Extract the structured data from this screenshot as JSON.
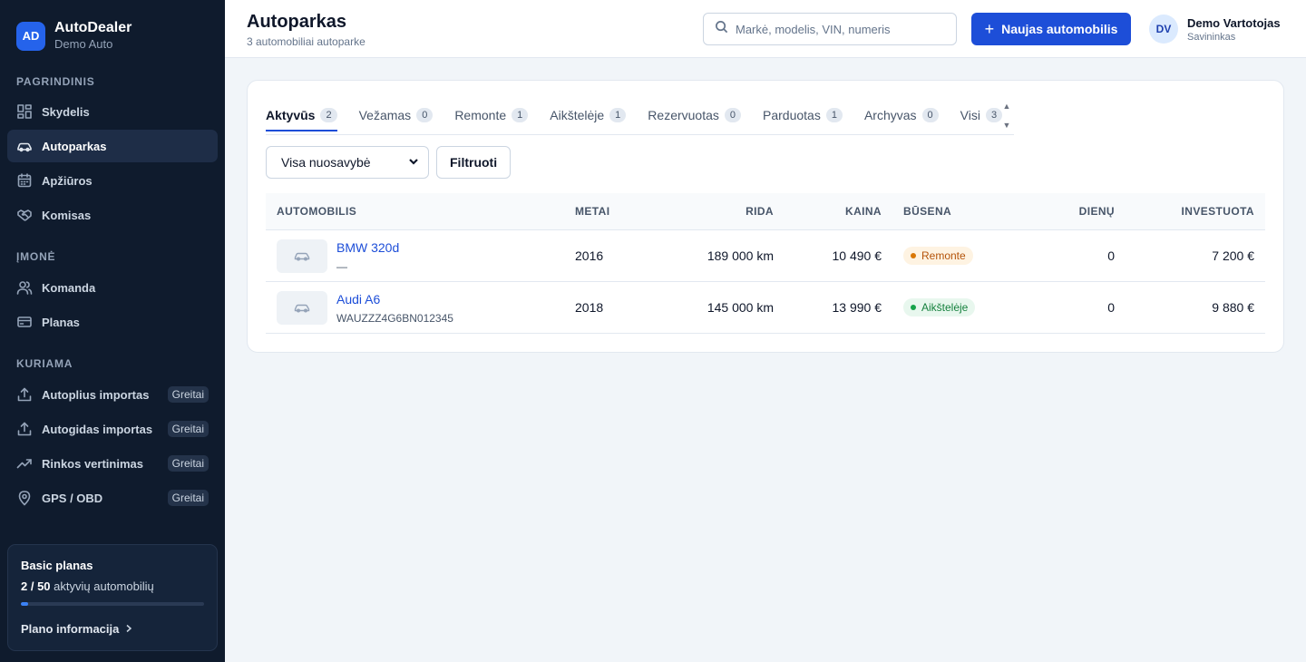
{
  "brand": {
    "logo": "AD",
    "name": "AutoDealer",
    "sub": "Demo Auto"
  },
  "sidebar": {
    "sections": [
      {
        "title": "PAGRINDINIS"
      },
      {
        "title": "ĮMONĖ"
      },
      {
        "title": "KURIAMA"
      }
    ],
    "items": [
      {
        "label": "Skydelis",
        "icon": "dashboard-icon"
      },
      {
        "label": "Autoparkas",
        "icon": "car-icon",
        "active": true
      },
      {
        "label": "Apžiūros",
        "icon": "calendar-icon"
      },
      {
        "label": "Komisas",
        "icon": "handshake-icon"
      },
      {
        "label": "Komanda",
        "icon": "users-icon"
      },
      {
        "label": "Planas",
        "icon": "credit-card-icon"
      },
      {
        "label": "Autoplius importas",
        "icon": "upload-icon",
        "badge": "Greitai"
      },
      {
        "label": "Autogidas importas",
        "icon": "upload-icon",
        "badge": "Greitai"
      },
      {
        "label": "Rinkos vertinimas",
        "icon": "trend-icon",
        "badge": "Greitai"
      },
      {
        "label": "GPS / OBD",
        "icon": "map-pin-icon",
        "badge": "Greitai"
      }
    ],
    "plan": {
      "title": "Basic planas",
      "usage_count": "2 / 50",
      "usage_text": "aktyvių automobilių",
      "usage_fraction": 0.04,
      "link": "Plano informacija"
    }
  },
  "header": {
    "title": "Autoparkas",
    "subtitle": "3 automobiliai autoparke",
    "search_placeholder": "Markė, modelis, VIN, numeris",
    "new_button": "Naujas automobilis",
    "user": {
      "initials": "DV",
      "name": "Demo Vartotojas",
      "role": "Savininkas"
    }
  },
  "tabs": [
    {
      "label": "Aktyvūs",
      "count": "2",
      "active": true
    },
    {
      "label": "Vežamas",
      "count": "0"
    },
    {
      "label": "Remonte",
      "count": "1"
    },
    {
      "label": "Aikštelėje",
      "count": "1"
    },
    {
      "label": "Rezervuotas",
      "count": "0"
    },
    {
      "label": "Parduotas",
      "count": "1"
    },
    {
      "label": "Archyvas",
      "count": "0"
    },
    {
      "label": "Visi",
      "count": "3"
    }
  ],
  "filters": {
    "ownership_select": "Visa nuosavybė",
    "filter_button": "Filtruoti"
  },
  "table": {
    "columns": [
      "AUTOMOBILIS",
      "METAI",
      "RIDA",
      "KAINA",
      "BŪSENA",
      "DIENŲ",
      "INVESTUOTA"
    ],
    "rows": [
      {
        "name": "BMW 320d",
        "vin": "—",
        "year": "2016",
        "mileage": "189 000 km",
        "price": "10 490 €",
        "status": "Remonte",
        "status_color": "#b45309",
        "status_bg": "#fef3e2",
        "status_dot": "#d97706",
        "days": "0",
        "invested": "7 200 €"
      },
      {
        "name": "Audi A6",
        "vin": "WAUZZZ4G6BN012345",
        "year": "2018",
        "mileage": "145 000 km",
        "price": "13 990 €",
        "status": "Aikštelėje",
        "status_color": "#15803d",
        "status_bg": "#e8f7ee",
        "status_dot": "#16a34a",
        "days": "0",
        "invested": "9 880 €"
      }
    ]
  }
}
